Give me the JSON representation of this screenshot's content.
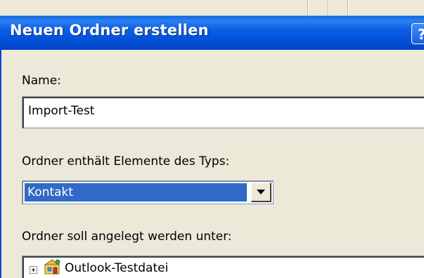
{
  "dialog": {
    "title": "Neuen Ordner erstellen",
    "help_label": "?"
  },
  "name_field": {
    "label": "Name:",
    "value": "Import-Test"
  },
  "type_field": {
    "label": "Ordner enthält Elemente des Typs:",
    "selected": "Kontakt"
  },
  "location_field": {
    "label": "Ordner soll angelegt werden unter:",
    "tree_items": [
      {
        "label": "Outlook-Testdatei",
        "icon": "outlook-today-icon",
        "expanded": false
      }
    ]
  },
  "colors": {
    "titlebar": "#0050d6",
    "dialog_bg": "#ece9d8",
    "selection": "#316ac5"
  }
}
